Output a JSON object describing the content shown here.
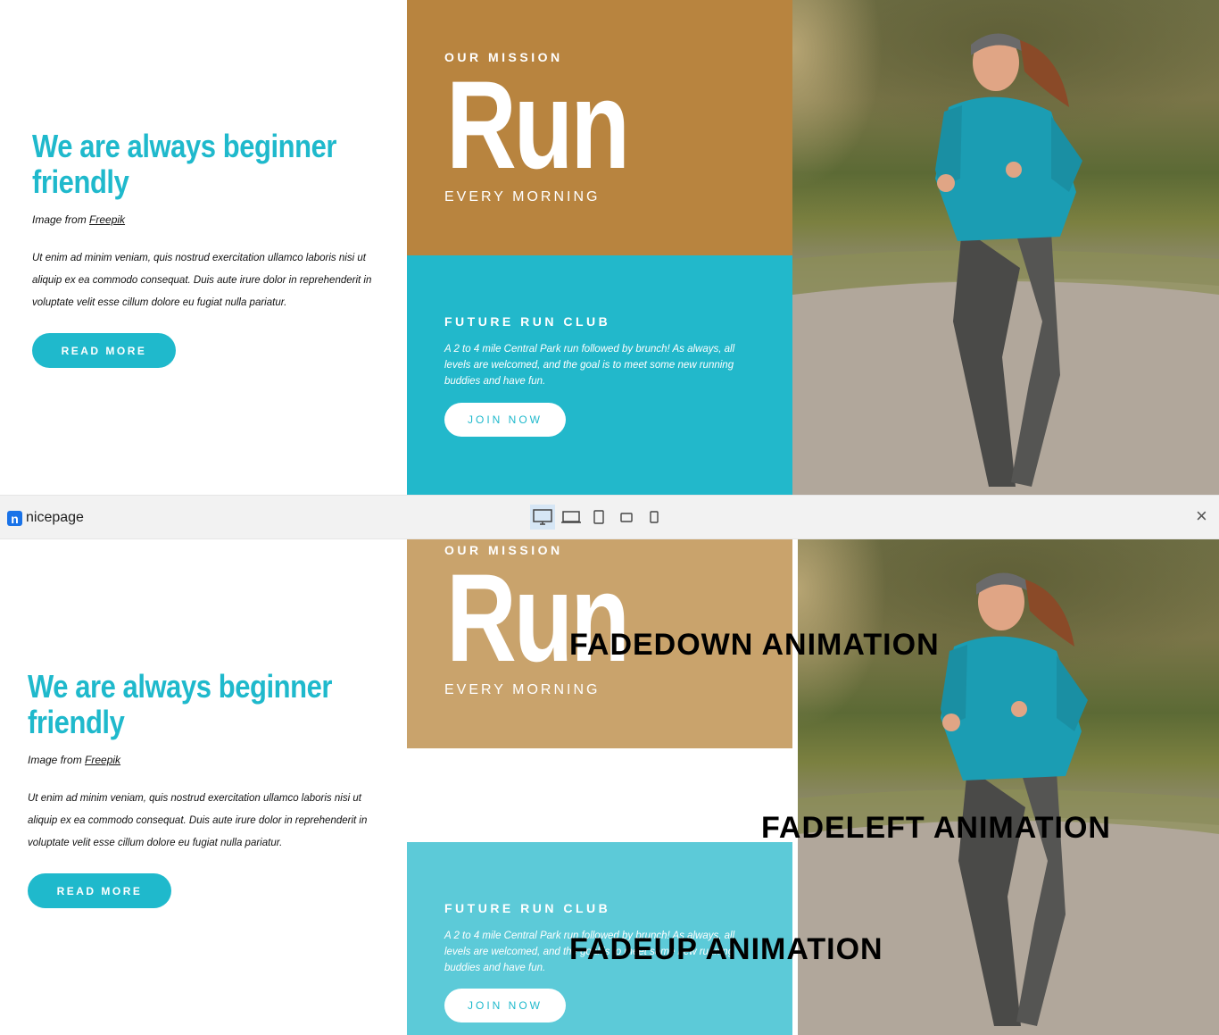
{
  "top": {
    "heading": "We are always beginner friendly",
    "credit_prefix": "Image from ",
    "credit_link": "Freepik",
    "paragraph": "Ut enim ad minim veniam, quis nostrud exercitation ullamco laboris nisi ut aliquip ex ea commodo consequat. Duis aute irure dolor in reprehenderit in voluptate velit esse cillum dolore eu fugiat nulla pariatur.",
    "read_more": "READ MORE",
    "mission_eyebrow": "OUR MISSION",
    "mission_big": "Run",
    "mission_sub": "EVERY MORNING",
    "club_title": "FUTURE RUN CLUB",
    "club_text": "A 2 to 4 mile Central Park run followed by brunch! As always, all levels are welcomed, and the goal is to meet some new running buddies and have fun.",
    "join_now": "JOIN NOW"
  },
  "toolbar": {
    "logo_mark": "n",
    "logo_text": "nicepage",
    "devices": [
      "desktop-icon",
      "laptop-icon",
      "tablet-icon",
      "tablet-landscape-icon",
      "phone-icon"
    ],
    "active_device": "desktop",
    "close": "×"
  },
  "bottom": {
    "heading": "We are always beginner friendly",
    "credit_prefix": "Image from ",
    "credit_link": "Freepik",
    "paragraph": "Ut enim ad minim veniam, quis nostrud exercitation ullamco laboris nisi ut aliquip ex ea commodo consequat. Duis aute irure dolor in reprehenderit in voluptate velit esse cillum dolore eu fugiat nulla pariatur.",
    "read_more": "READ MORE",
    "mission_eyebrow": "OUR MISSION",
    "mission_big": "Run",
    "mission_sub": "EVERY MORNING",
    "club_title": "FUTURE RUN CLUB",
    "club_text": "A 2 to 4 mile Central Park run followed by brunch! As always, all levels are welcomed, and the goal is to meet some new running buddies and have fun.",
    "join_now": "JOIN NOW"
  },
  "annotations": {
    "fadedown": "FADEDOWN ANIMATION",
    "fadeleft": "FADELEFT ANIMATION",
    "fadeup": "FADEUP ANIMATION"
  },
  "colors": {
    "accent": "#1fb9cc",
    "mission": "#b8843f",
    "club": "#22b8cb",
    "toolbar": "#f2f2f2"
  }
}
